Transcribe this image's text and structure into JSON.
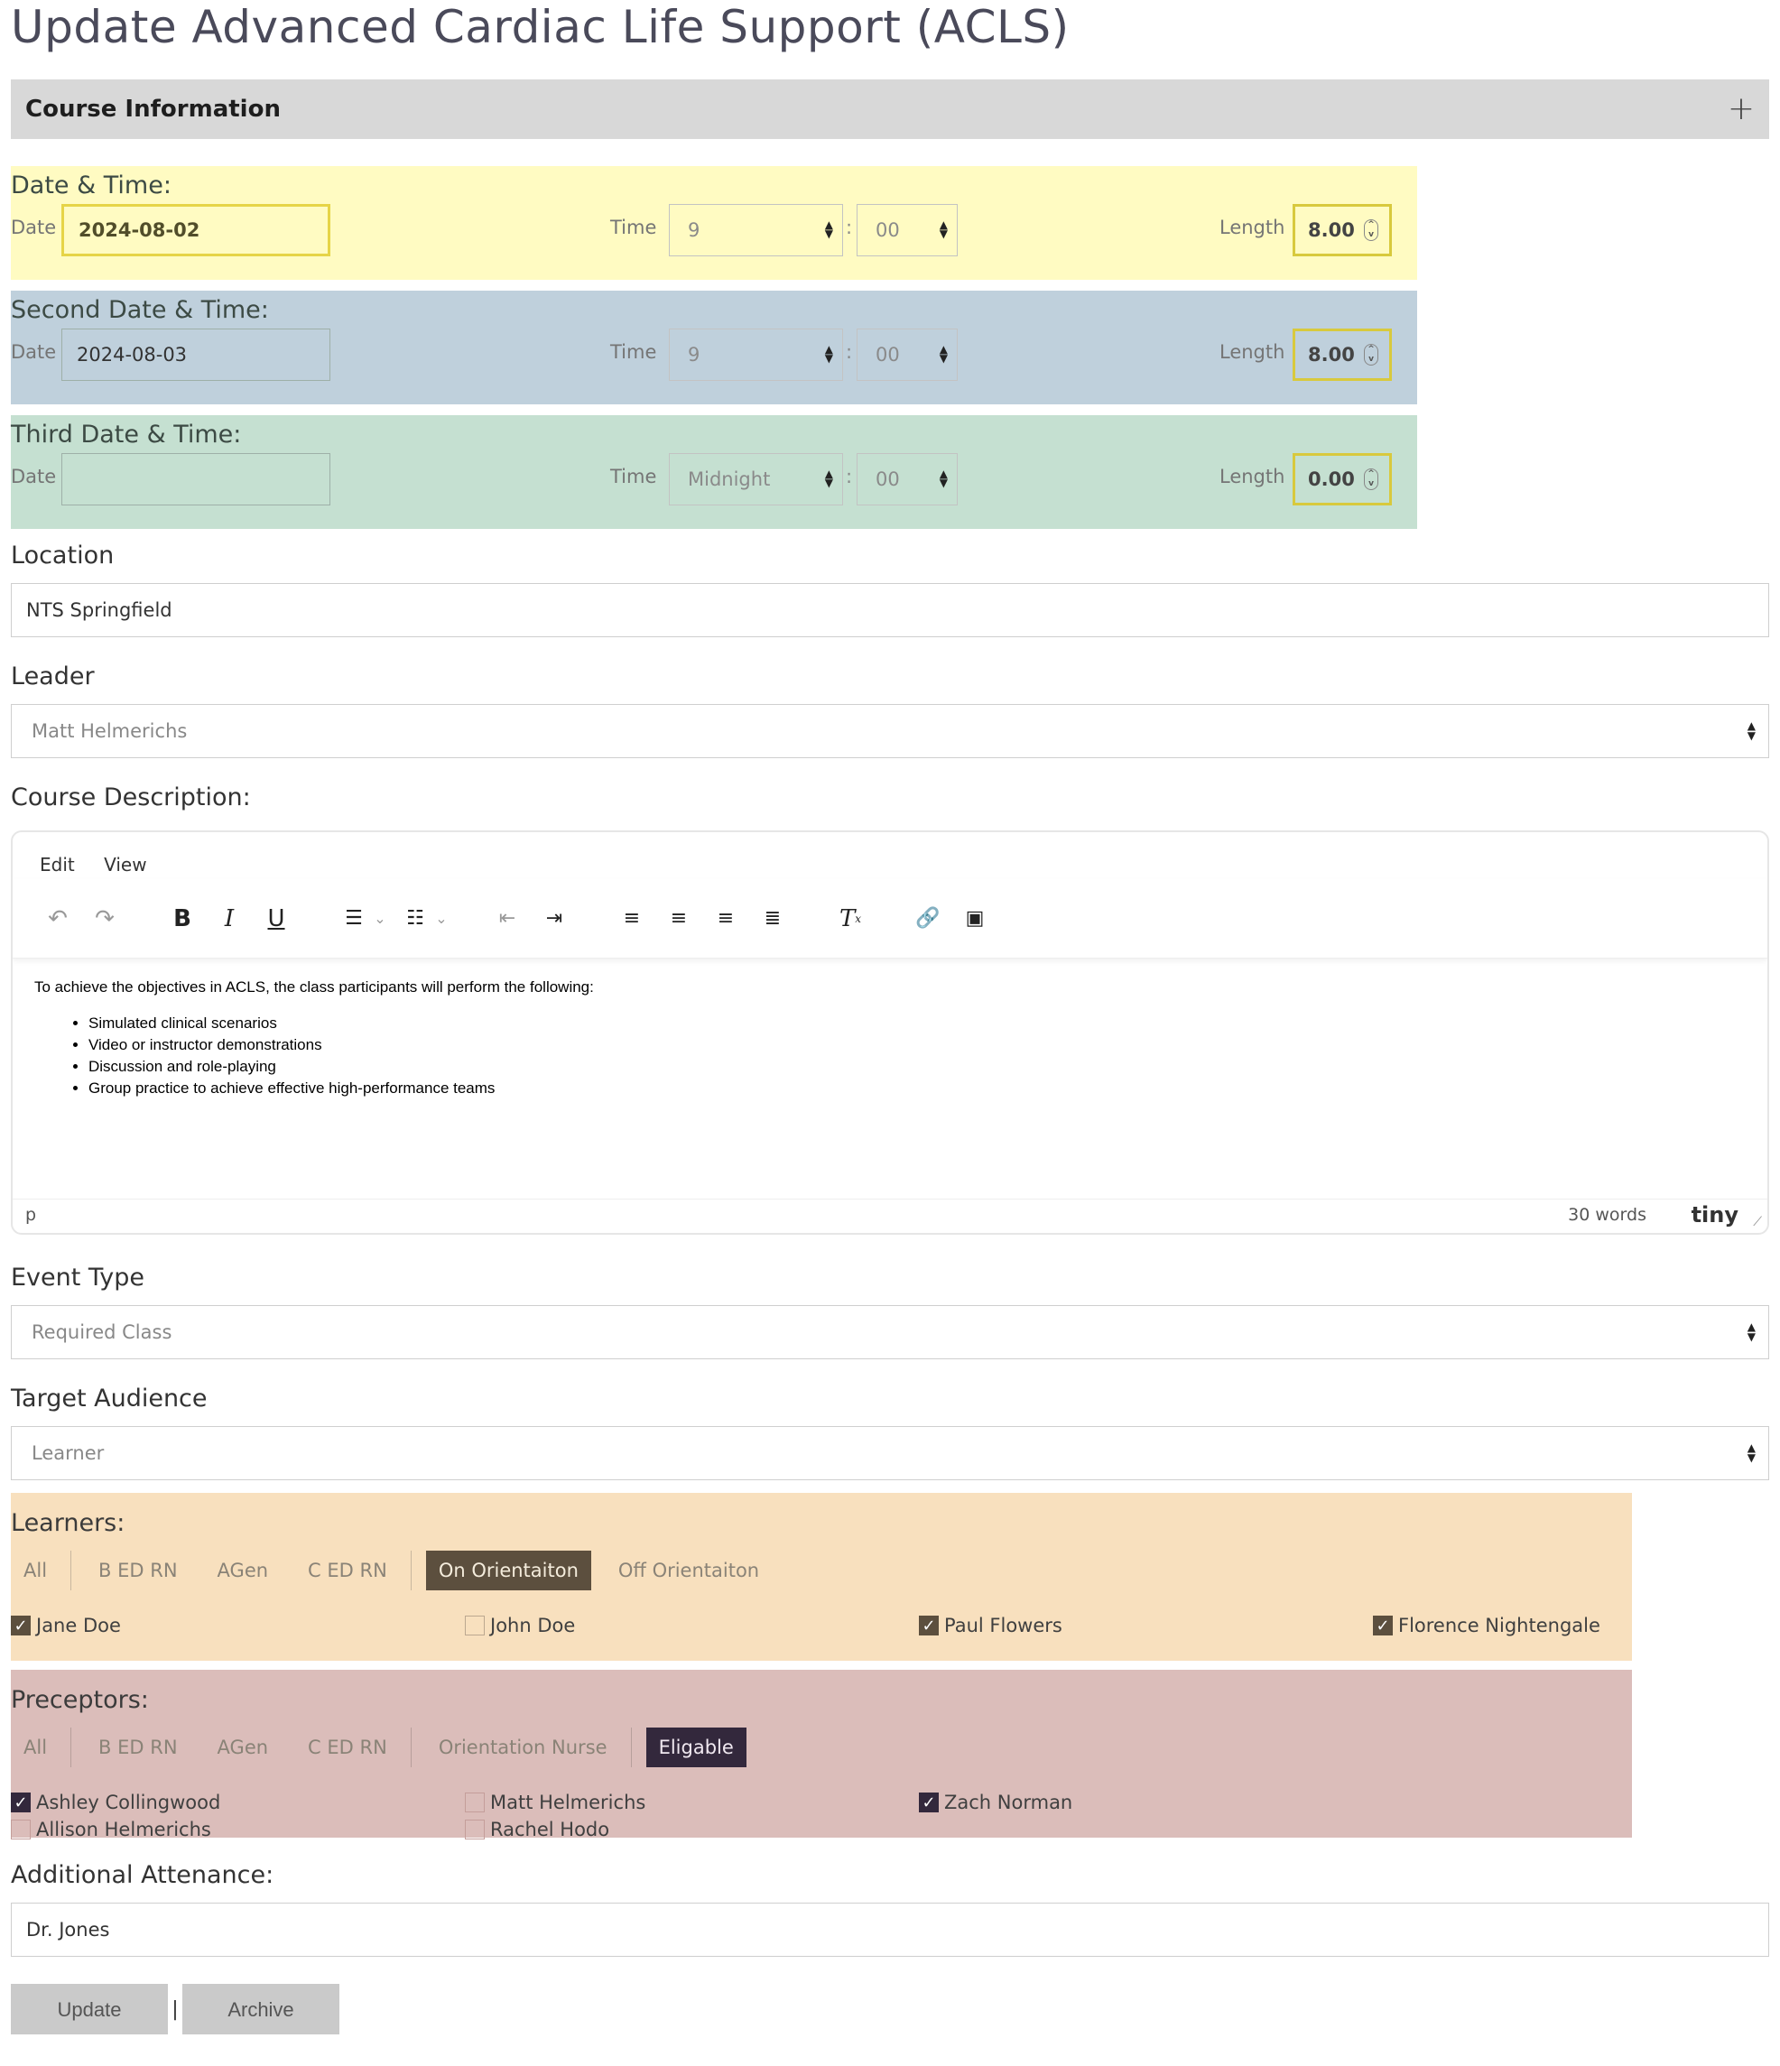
{
  "page": {
    "title": "Update Advanced Cardiac Life Support (ACLS)"
  },
  "section": {
    "title": "Course Information",
    "toggle": "+"
  },
  "datetime": [
    {
      "heading": "Date & Time:",
      "date_label": "Date",
      "date": "2024-08-02",
      "time_label": "Time",
      "hour": "9",
      "minute": "00",
      "length_label": "Length",
      "length": "8.00"
    },
    {
      "heading": "Second Date & Time:",
      "date_label": "Date",
      "date": "2024-08-03",
      "time_label": "Time",
      "hour": "9",
      "minute": "00",
      "length_label": "Length",
      "length": "8.00"
    },
    {
      "heading": "Third Date & Time:",
      "date_label": "Date",
      "date": "",
      "time_label": "Time",
      "hour": "Midnight",
      "minute": "00",
      "length_label": "Length",
      "length": "0.00"
    }
  ],
  "location": {
    "label": "Location",
    "value": "NTS Springfield"
  },
  "leader": {
    "label": "Leader",
    "value": "Matt Helmerichs"
  },
  "description": {
    "label": "Course Description:",
    "menu": [
      "Edit",
      "View"
    ],
    "intro": "To achieve the objectives in ACLS, the class participants will perform the following:",
    "items": [
      "Simulated clinical scenarios",
      "Video or instructor demonstrations",
      "Discussion and role-playing",
      "Group practice to achieve effective high-performance teams"
    ],
    "status_element": "p",
    "word_count": "30 words",
    "brand": "tiny"
  },
  "event_type": {
    "label": "Event Type",
    "value": "Required Class"
  },
  "target_audience": {
    "label": "Target Audience",
    "value": "Learner"
  },
  "learners": {
    "label": "Learners:",
    "filters": [
      "All",
      "B ED RN",
      "AGen",
      "C ED RN",
      "On Orientaiton",
      "Off Orientaiton"
    ],
    "active_filter": "On Orientaiton",
    "people": [
      {
        "name": "Jane Doe",
        "checked": true
      },
      {
        "name": "John Doe",
        "checked": false
      },
      {
        "name": "Paul Flowers",
        "checked": true
      },
      {
        "name": "Florence Nightengale",
        "checked": true
      }
    ]
  },
  "preceptors": {
    "label": "Preceptors:",
    "filters": [
      "All",
      "B ED RN",
      "AGen",
      "C ED RN",
      "Orientation Nurse",
      "Eligable"
    ],
    "active_filter": "Eligable",
    "people": [
      {
        "name": "Ashley Collingwood",
        "checked": true
      },
      {
        "name": "Matt Helmerichs",
        "checked": false
      },
      {
        "name": "Zach Norman",
        "checked": true
      },
      {
        "name": "Allison Helmerichs",
        "checked": false
      },
      {
        "name": "Rachel Hodo",
        "checked": false
      }
    ]
  },
  "additional": {
    "label": "Additional Attenance:",
    "value": "Dr. Jones"
  },
  "actions": {
    "update": "Update",
    "separator": "|",
    "archive": "Archive"
  },
  "colors": {
    "date1_bg": "#fffbc2",
    "date2_bg": "#bfd0dc",
    "date3_bg": "#c5e0d1",
    "learners_bg": "#f8e0be",
    "preceptors_bg": "#dbbdba",
    "header_bg": "#d8d8d8"
  }
}
